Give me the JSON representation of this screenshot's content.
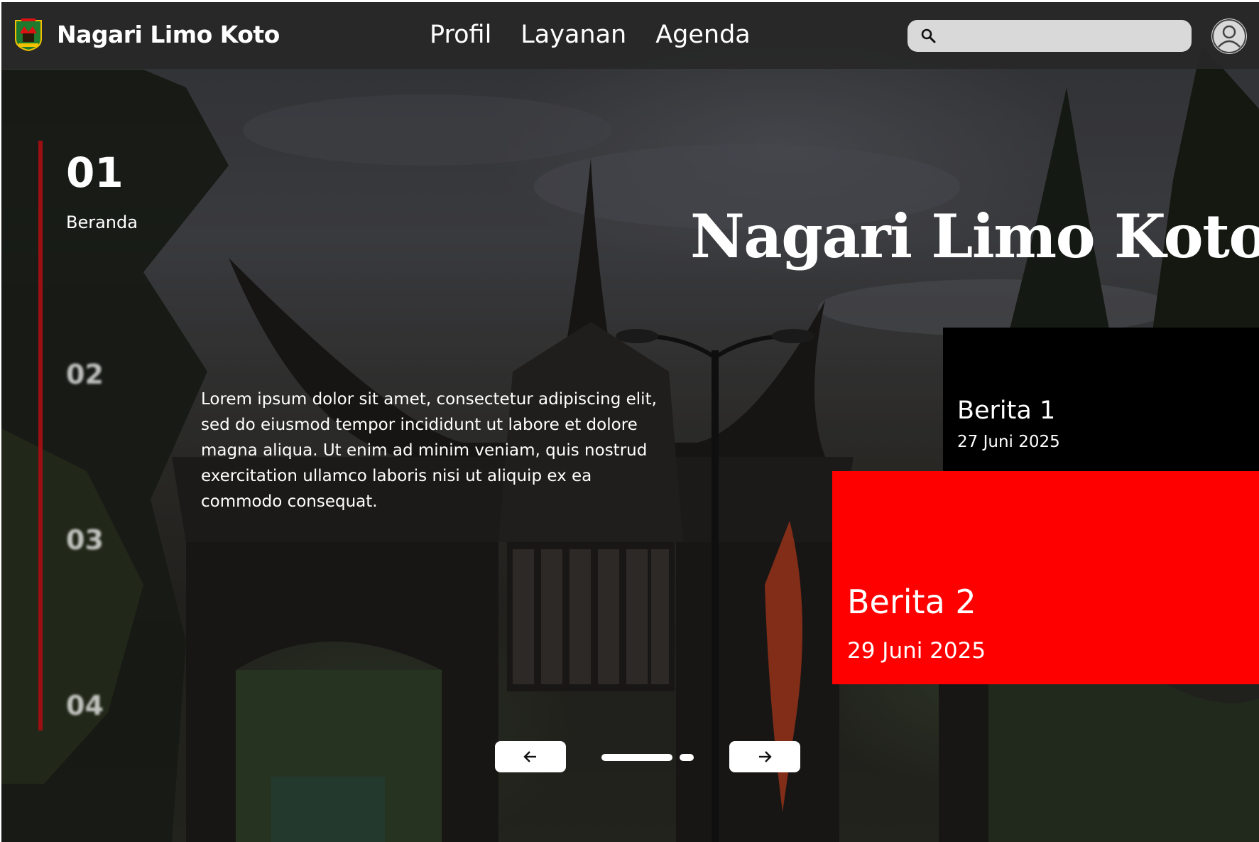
{
  "header": {
    "brand": "Nagari Limo Koto",
    "nav": [
      "Profil",
      "Layanan",
      "Agenda"
    ],
    "search_placeholder": "",
    "icons": {
      "logo": "west-sumatra-emblem",
      "search": "search-icon",
      "avatar": "user-icon"
    }
  },
  "sidebar": {
    "slides": [
      {
        "number": "01",
        "label": "Beranda",
        "active": true
      },
      {
        "number": "02",
        "active": false
      },
      {
        "number": "03",
        "active": false
      },
      {
        "number": "04",
        "active": false
      }
    ],
    "accent_color": "#9b0f12"
  },
  "hero": {
    "title": "Nagari Limo Koto",
    "body": "Lorem ipsum dolor sit amet, consectetur adipiscing elit, sed do eiusmod tempor incididunt ut labore et dolore magna aliqua. Ut enim ad minim veniam, quis nostrud exercitation ullamco laboris nisi ut aliquip ex ea commodo consequat."
  },
  "news": [
    {
      "title": "Berita 1",
      "date": "27 Juni 2025",
      "color": "#000000"
    },
    {
      "title": "Berita 2",
      "date": "29 Juni 2025",
      "color": "#ff0000"
    }
  ],
  "carousel": {
    "prev_icon": "arrow-left-icon",
    "next_icon": "arrow-right-icon"
  }
}
